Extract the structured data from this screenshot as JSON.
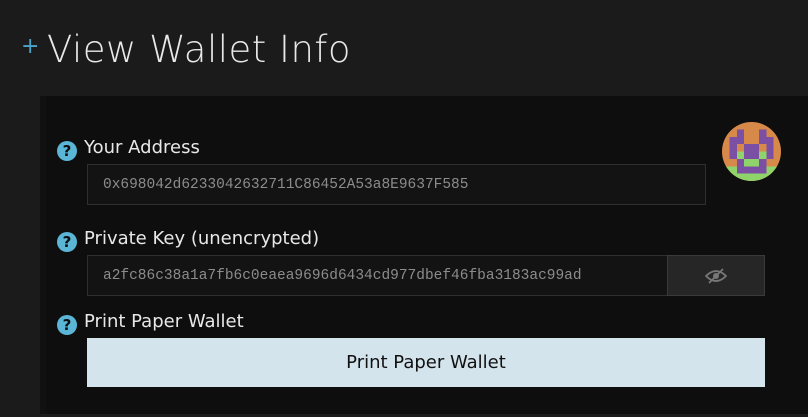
{
  "header": {
    "expand_icon": "plus-icon",
    "title": "View Wallet Info"
  },
  "address": {
    "help_icon": "question-icon",
    "label": "Your Address",
    "value": "0x698042d6233042632711C86452A53a8E9637F585"
  },
  "private_key": {
    "help_icon": "question-icon",
    "label": "Private Key (unencrypted)",
    "value": "a2fc86c38a1a7fb6c0eaea9696d6434cd977dbef46fba3183ac99ad",
    "toggle_icon": "eye-slash-icon"
  },
  "paper_wallet": {
    "help_icon": "question-icon",
    "label": "Print Paper Wallet",
    "button_label": "Print Paper Wallet"
  },
  "avatar": {
    "icon": "identicon"
  },
  "colors": {
    "accent": "#5bb5d6",
    "button_bg": "#d3e4ec",
    "page_bg": "#1b1b1b",
    "panel_bg": "#0e0e0e"
  }
}
